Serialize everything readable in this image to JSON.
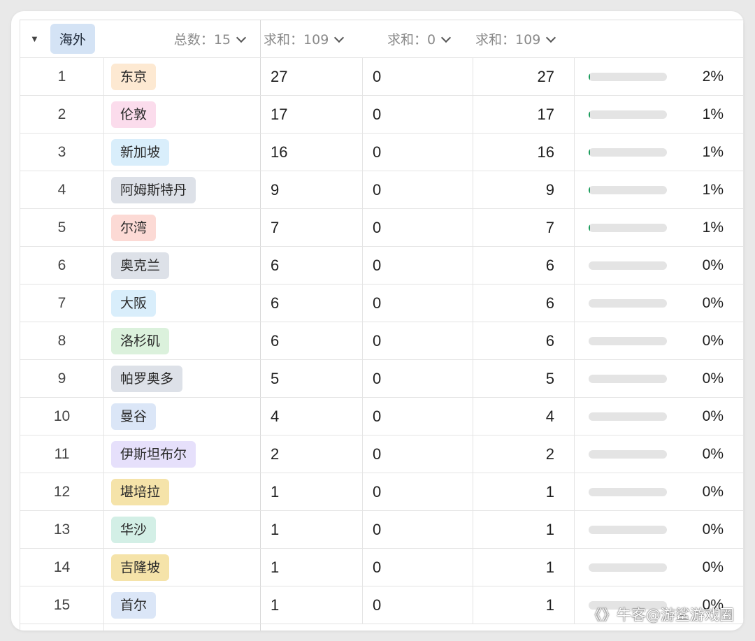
{
  "group": {
    "caret": "▼",
    "name": "海外",
    "name_color": "#d4e3f5",
    "total_label": "总数：",
    "total_value": "15",
    "agg1_label": "求和：",
    "agg1_value": "109",
    "agg2_label": "求和：",
    "agg2_value": "0",
    "agg3_label": "求和：",
    "agg3_value": "109"
  },
  "rows": [
    {
      "index": "1",
      "city": "东京",
      "tag_color": "#fde9d2",
      "a": "27",
      "b": "0",
      "c": "27",
      "progress": 0.02,
      "pct": "2%"
    },
    {
      "index": "2",
      "city": "伦敦",
      "tag_color": "#fbdcec",
      "a": "17",
      "b": "0",
      "c": "17",
      "progress": 0.01,
      "pct": "1%"
    },
    {
      "index": "3",
      "city": "新加坡",
      "tag_color": "#d9eefb",
      "a": "16",
      "b": "0",
      "c": "16",
      "progress": 0.01,
      "pct": "1%"
    },
    {
      "index": "4",
      "city": "阿姆斯特丹",
      "tag_color": "#dde1e8",
      "a": "9",
      "b": "0",
      "c": "9",
      "progress": 0.01,
      "pct": "1%"
    },
    {
      "index": "5",
      "city": "尔湾",
      "tag_color": "#fcdad5",
      "a": "7",
      "b": "0",
      "c": "7",
      "progress": 0.01,
      "pct": "1%"
    },
    {
      "index": "6",
      "city": "奥克兰",
      "tag_color": "#dde1e8",
      "a": "6",
      "b": "0",
      "c": "6",
      "progress": 0.0,
      "pct": "0%"
    },
    {
      "index": "7",
      "city": "大阪",
      "tag_color": "#d9eefb",
      "a": "6",
      "b": "0",
      "c": "6",
      "progress": 0.0,
      "pct": "0%"
    },
    {
      "index": "8",
      "city": "洛杉矶",
      "tag_color": "#dbf1dc",
      "a": "6",
      "b": "0",
      "c": "6",
      "progress": 0.0,
      "pct": "0%"
    },
    {
      "index": "9",
      "city": "帕罗奥多",
      "tag_color": "#dde1e8",
      "a": "5",
      "b": "0",
      "c": "5",
      "progress": 0.0,
      "pct": "0%"
    },
    {
      "index": "10",
      "city": "曼谷",
      "tag_color": "#dbe6f7",
      "a": "4",
      "b": "0",
      "c": "4",
      "progress": 0.0,
      "pct": "0%"
    },
    {
      "index": "11",
      "city": "伊斯坦布尔",
      "tag_color": "#e6e0fb",
      "a": "2",
      "b": "0",
      "c": "2",
      "progress": 0.0,
      "pct": "0%"
    },
    {
      "index": "12",
      "city": "堪培拉",
      "tag_color": "#f5e3a9",
      "a": "1",
      "b": "0",
      "c": "1",
      "progress": 0.0,
      "pct": "0%"
    },
    {
      "index": "13",
      "city": "华沙",
      "tag_color": "#d3efe6",
      "a": "1",
      "b": "0",
      "c": "1",
      "progress": 0.0,
      "pct": "0%"
    },
    {
      "index": "14",
      "city": "吉隆坡",
      "tag_color": "#f5e3a9",
      "a": "1",
      "b": "0",
      "c": "1",
      "progress": 0.0,
      "pct": "0%"
    },
    {
      "index": "15",
      "city": "首尔",
      "tag_color": "#dbe6f7",
      "a": "1",
      "b": "0",
      "c": "1",
      "progress": 0.0,
      "pct": "0%"
    }
  ],
  "colors": {
    "progress_fill": "#1a9c5b",
    "progress_track": "#e4e4e4"
  },
  "watermark": "《》牛客@游鲨游戏圈"
}
